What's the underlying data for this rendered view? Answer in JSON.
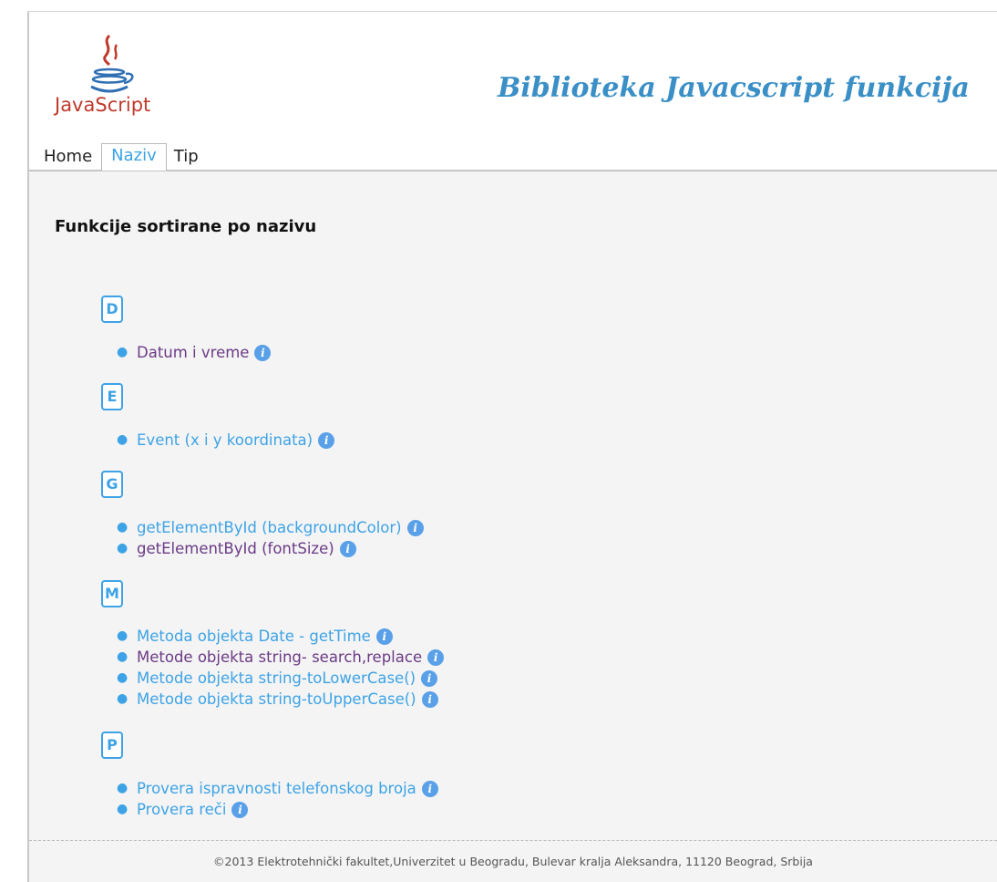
{
  "header": {
    "logo_text": "JavaScript",
    "title": "Biblioteka Javacscript funkcija"
  },
  "nav": {
    "items": [
      {
        "label": "Home"
      },
      {
        "label": "Naziv"
      },
      {
        "label": "Tip"
      }
    ],
    "active": "Naziv"
  },
  "main": {
    "heading": "Funkcije sortirane po nazivu",
    "groups": [
      {
        "letter": "D",
        "items": [
          {
            "label": "Datum i vreme",
            "visited": true
          }
        ]
      },
      {
        "letter": "E",
        "items": [
          {
            "label": "Event (x i y koordinata)",
            "visited": false
          }
        ]
      },
      {
        "letter": "G",
        "items": [
          {
            "label": "getElementById (backgroundColor)",
            "visited": false
          },
          {
            "label": "getElementById (fontSize)",
            "visited": true
          }
        ]
      },
      {
        "letter": "M",
        "items": [
          {
            "label": "Metoda objekta Date - getTime",
            "visited": false
          },
          {
            "label": "Metode objekta string- search,replace",
            "visited": true
          },
          {
            "label": "Metode objekta string-toLowerCase()",
            "visited": false
          },
          {
            "label": "Metode objekta string-toUpperCase()",
            "visited": false
          }
        ]
      },
      {
        "letter": "P",
        "items": [
          {
            "label": "Provera ispravnosti telefonskog broja",
            "visited": false
          },
          {
            "label": "Provera reči",
            "visited": false
          }
        ]
      }
    ],
    "info_icon_glyph": "i"
  },
  "footer": {
    "text": "©2013 Elektrotehnički fakultet,Univerzitet u Beogradu, Bulevar kralja Aleksandra, 11120 Beograd, Srbija"
  },
  "colors": {
    "link": "#3da3e6",
    "visited": "#6b3a86",
    "title": "#3a8fc7",
    "logo": "#c0392b"
  }
}
